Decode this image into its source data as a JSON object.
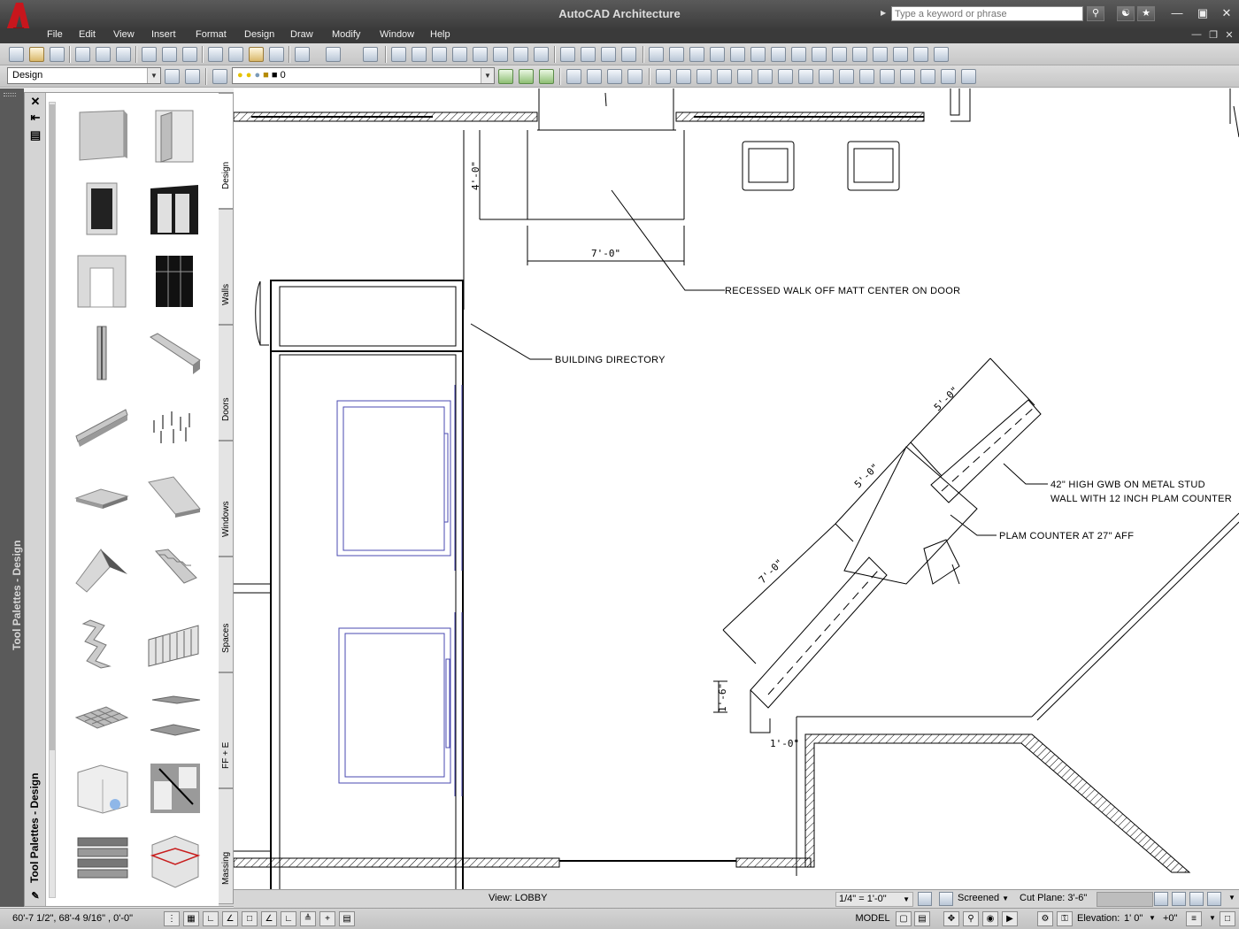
{
  "window": {
    "title": "AutoCAD Architecture",
    "search_placeholder": "Type a keyword or phrase"
  },
  "menu": [
    "File",
    "Edit",
    "View",
    "Insert",
    "Format",
    "Design",
    "Draw",
    "Modify",
    "Window",
    "Help"
  ],
  "toolbar": {
    "workspace": "Design",
    "layer": "0"
  },
  "palette": {
    "strip_title": "Tool Palettes - Design",
    "title": "Tool Palettes - Design",
    "tabs": [
      "Design",
      "Walls",
      "Doors",
      "Windows",
      "Spaces",
      "FF + E",
      "Massing"
    ],
    "active_tab": "Design",
    "tools": [
      "wall-tool-icon",
      "door-tool-icon",
      "window-tool-icon",
      "door-frame-tool-icon",
      "opening-tool-icon",
      "curtain-wall-tool-icon",
      "column-tool-icon",
      "beam-tool-icon",
      "brace-tool-icon",
      "grid-tool-icon",
      "slab-tool-icon",
      "roof-slab-tool-icon",
      "roof-tool-icon",
      "stair-tool-icon",
      "stair-winder-tool-icon",
      "railing-tool-icon",
      "ceiling-grid-tool-icon",
      "space-tool-icon",
      "zone-tool-icon",
      "section-tool-icon",
      "mass-stack-tool-icon",
      "mass-box-tool-icon"
    ]
  },
  "drawing": {
    "notes": {
      "mat": "RECESSED WALK OFF MATT CENTER ON DOOR",
      "directory": "BUILDING DIRECTORY",
      "gwb_line1": "42\" HIGH GWB ON METAL STUD",
      "gwb_line2": "WALL WITH 12 INCH PLAM COUNTER",
      "plam": "PLAM COUNTER AT 27\" AFF"
    },
    "dims": {
      "d1": "4'-0\"",
      "d2": "7'-0\"",
      "d3": "5'-0\"",
      "d4": "5'-0\"",
      "d5": "7'-0\"",
      "d6": "1'-6\"",
      "d7": "1'-0\""
    }
  },
  "viewbar": {
    "view": "View: LOBBY",
    "scale": "1/4\" = 1'-0\"",
    "display": "Screened",
    "cut_plane": "Cut Plane: 3'-6\""
  },
  "statusbar": {
    "coords": "60'-7 1/2\",  68'-4 9/16\" , 0'-0\"",
    "model": "MODEL",
    "elevation_label": "Elevation:",
    "elevation_value": "1' 0\"",
    "elevation_offset": "+0\""
  },
  "colors": {
    "title_bar": "#4a4a4a",
    "menu_bar": "#3a3a3a",
    "logo_red": "#c8161d",
    "drawing_bg": "#ffffff",
    "furniture_blue": "#4a4ab0"
  }
}
